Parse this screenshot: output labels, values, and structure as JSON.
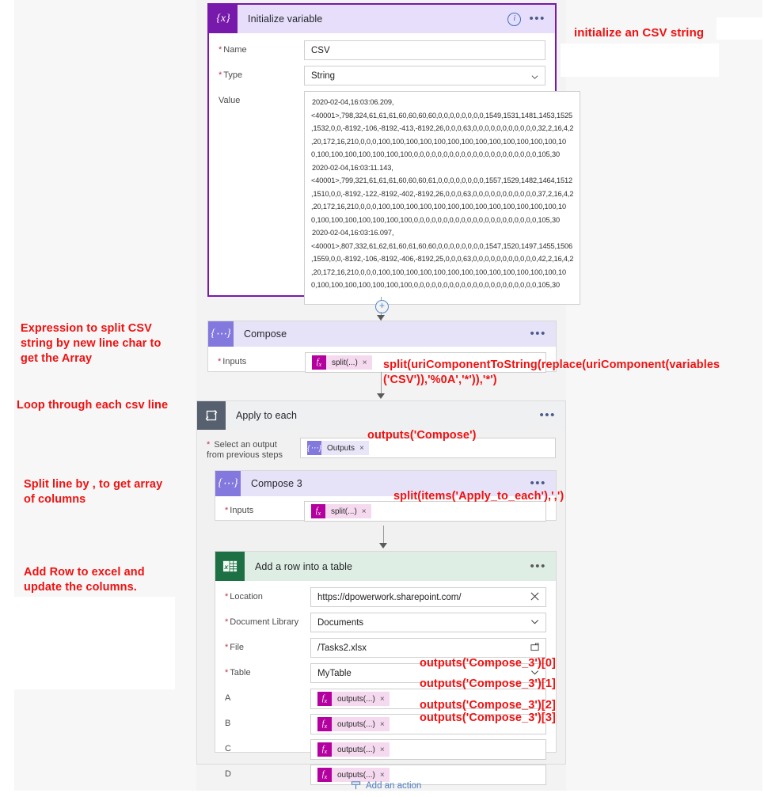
{
  "flow": {
    "init_variable": {
      "icon": "variable-braces-icon",
      "title": "Initialize variable",
      "info_glyph": "i",
      "more_glyph": "•••",
      "fields": {
        "name_label": "Name",
        "name_value": "CSV",
        "type_label": "Type",
        "type_value": "String",
        "value_label": "Value",
        "value_lines": [
          "2020-02-04,16:03:06.209,",
          "<40001>,798,324,61,61,61,60,60,60,60,0,0,0,0,0,0,0,0,1549,1531,1481,1453,1525",
          ",1532,0,0,-8192,-106,-8192,-413,-8192,26,0,0,0,63,0,0,0,0,0,0,0,0,0,0,0,32,2,16,4,2",
          ",20,172,16,210,0,0,0,100,100,100,100,100,100,100,100,100,100,100,100,100,10",
          "0,100,100,100,100,100,100,100,0,0,0,0,0,0,0,0,0,0,0,0,0,0,0,0,0,0,0,0,0,105,30",
          "2020-02-04,16:03:11.143,",
          "<40001>,799,321,61,61,61,60,60,60,61,0,0,0,0,0,0,0,0,1557,1529,1482,1464,1512",
          ",1510,0,0,-8192,-122,-8192,-402,-8192,26,0,0,0,63,0,0,0,0,0,0,0,0,0,0,0,37,2,16,4,2",
          ",20,172,16,210,0,0,0,100,100,100,100,100,100,100,100,100,100,100,100,100,10",
          "0,100,100,100,100,100,100,100,0,0,0,0,0,0,0,0,0,0,0,0,0,0,0,0,0,0,0,0,0,105,30",
          "2020-02-04,16:03:16.097,",
          "<40001>,807,332,61,62,61,60,61,60,60,0,0,0,0,0,0,0,0,1547,1520,1497,1455,1506",
          ",1559,0,0,-8192,-106,-8192,-406,-8192,25,0,0,0,63,0,0,0,0,0,0,0,0,0,0,0,42,2,16,4,2",
          ",20,172,16,210,0,0,0,100,100,100,100,100,100,100,100,100,100,100,100,100,10",
          "0,100,100,100,100,100,100,100,0,0,0,0,0,0,0,0,0,0,0,0,0,0,0,0,0,0,0,0,0,105,30"
        ]
      }
    },
    "plus_node": {
      "glyph": "+"
    },
    "compose": {
      "icon": "compose-pencil-icon",
      "title": "Compose",
      "more_glyph": "•••",
      "inputs_label": "Inputs",
      "token_icon": "fx-icon",
      "token_label": "split(...)",
      "token_remove": "×"
    },
    "apply_to_each": {
      "icon": "loop-icon",
      "title": "Apply to each",
      "more_glyph": "•••",
      "select_label_line1": "Select an output",
      "select_label_line2": "from previous steps",
      "select_token_icon": "compose-output-icon",
      "select_token_label": "Outputs",
      "select_token_remove": "×",
      "compose3": {
        "icon": "compose-pencil-icon",
        "title": "Compose 3",
        "more_glyph": "•••",
        "inputs_label": "Inputs",
        "token_icon": "fx-icon",
        "token_label": "split(...)",
        "token_remove": "×"
      },
      "add_row": {
        "icon": "excel-icon",
        "title": "Add a row into a table",
        "more_glyph": "•••",
        "rows": [
          {
            "label": "Location",
            "value": "https://dpowerwork.sharepoint.com/",
            "required": true,
            "right_icon": "close-icon"
          },
          {
            "label": "Document Library",
            "value": "Documents",
            "required": true,
            "right_icon": "chevron-down-icon"
          },
          {
            "label": "File",
            "value": "/Tasks2.xlsx",
            "required": true,
            "right_icon": "folder-icon"
          },
          {
            "label": "Table",
            "value": "MyTable",
            "required": true,
            "right_icon": "chevron-down-icon"
          }
        ],
        "columns": [
          {
            "label": "A",
            "token_icon": "fx-icon",
            "token_label": "outputs(...)",
            "token_remove": "×"
          },
          {
            "label": "B",
            "token_icon": "fx-icon",
            "token_label": "outputs(...)",
            "token_remove": "×"
          },
          {
            "label": "C",
            "token_icon": "fx-icon",
            "token_label": "outputs(...)",
            "token_remove": "×"
          },
          {
            "label": "D",
            "token_icon": "fx-icon",
            "token_label": "outputs(...)",
            "token_remove": "×"
          }
        ]
      }
    },
    "add_action": {
      "label": "Add an action",
      "icon": "add-action-icon"
    }
  },
  "annotations": {
    "init_csv": "initialize an CSV string",
    "expression_split": "Expression to split CSV\nstring by new line char to\nget the Array",
    "expression_split_l1": "Expression to split CSV",
    "expression_split_l2": "string by new line char to",
    "expression_split_l3": "get the Array",
    "loop_each_line": "Loop through each csv line",
    "split_columns_l1": "Split line by , to get array",
    "split_columns_l2": "of columns",
    "add_row_l1": "Add Row to excel and",
    "add_row_l2": "update the columns.",
    "compose_expr_l1": "split(uriComponentToString(replace(uriComponent(variables",
    "compose_expr_l2": "('CSV')),'%0A','*')),'*')",
    "outputs_compose": "outputs('Compose')",
    "split_items": "split(items('Apply_to_each'),',')",
    "col_a": "outputs('Compose_3')[0]",
    "col_b": "outputs('Compose_3')[1]",
    "col_c": "outputs('Compose_3')[2]",
    "col_d": "outputs('Compose_3')[3]"
  },
  "colors": {
    "annotation_red": "#ef1111",
    "variable_purple": "#7719aa",
    "compose_lilac": "#8378de",
    "excel_green": "#1d7044",
    "loop_slate": "#56606e",
    "fx_magenta": "#b4009e"
  }
}
